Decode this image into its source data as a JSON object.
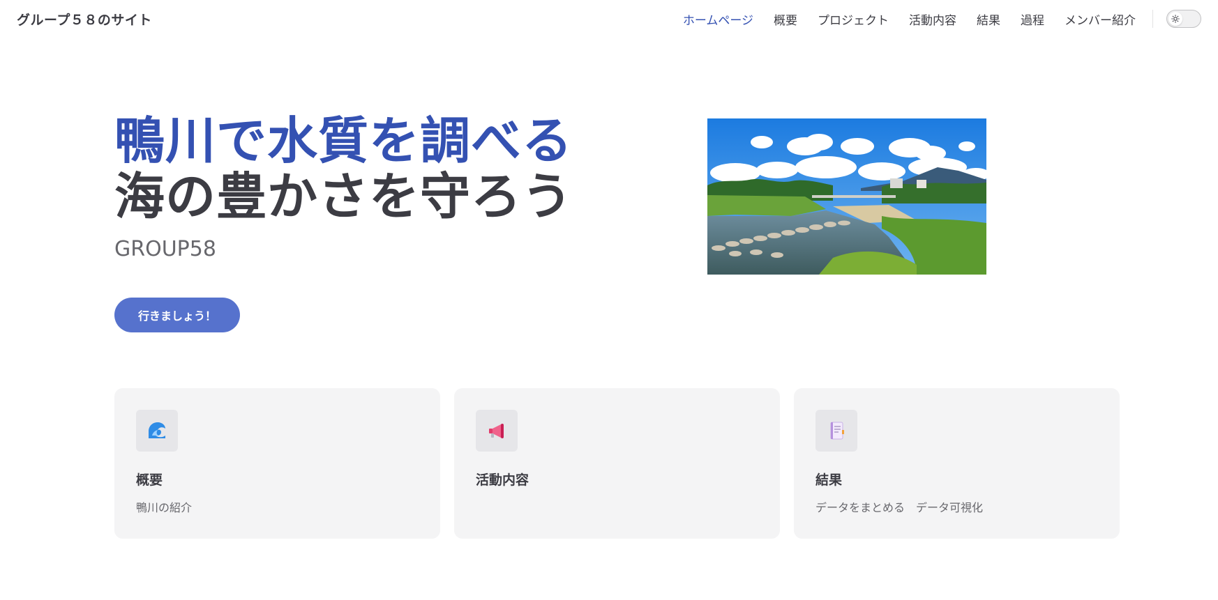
{
  "navbar": {
    "site_title": "グループ５８のサイト",
    "links": [
      {
        "label": "ホームページ",
        "active": true
      },
      {
        "label": "概要"
      },
      {
        "label": "プロジェクト"
      },
      {
        "label": "活動内容"
      },
      {
        "label": "結果"
      },
      {
        "label": "過程"
      },
      {
        "label": "メンバー紹介"
      }
    ],
    "theme_toggle_icon": "sun-icon"
  },
  "hero": {
    "name": "鴨川で水質を調べる",
    "text": "海の豊かさを守ろう",
    "tagline": "GROUP58",
    "action_label": "行きましょう！",
    "image_icon": "river-landscape-image"
  },
  "features": [
    {
      "icon": "wave-icon",
      "title": "概要",
      "details": "鴨川の紹介"
    },
    {
      "icon": "megaphone-icon",
      "title": "活動内容",
      "details": ""
    },
    {
      "icon": "notebook-icon",
      "title": "結果",
      "details": "データをまとめる　データ可視化"
    }
  ],
  "colors": {
    "brand": "#3451b2",
    "button_bg": "#5672cd",
    "text": "#3c3c43",
    "muted": "#67676c",
    "card_bg": "#f4f4f5"
  }
}
